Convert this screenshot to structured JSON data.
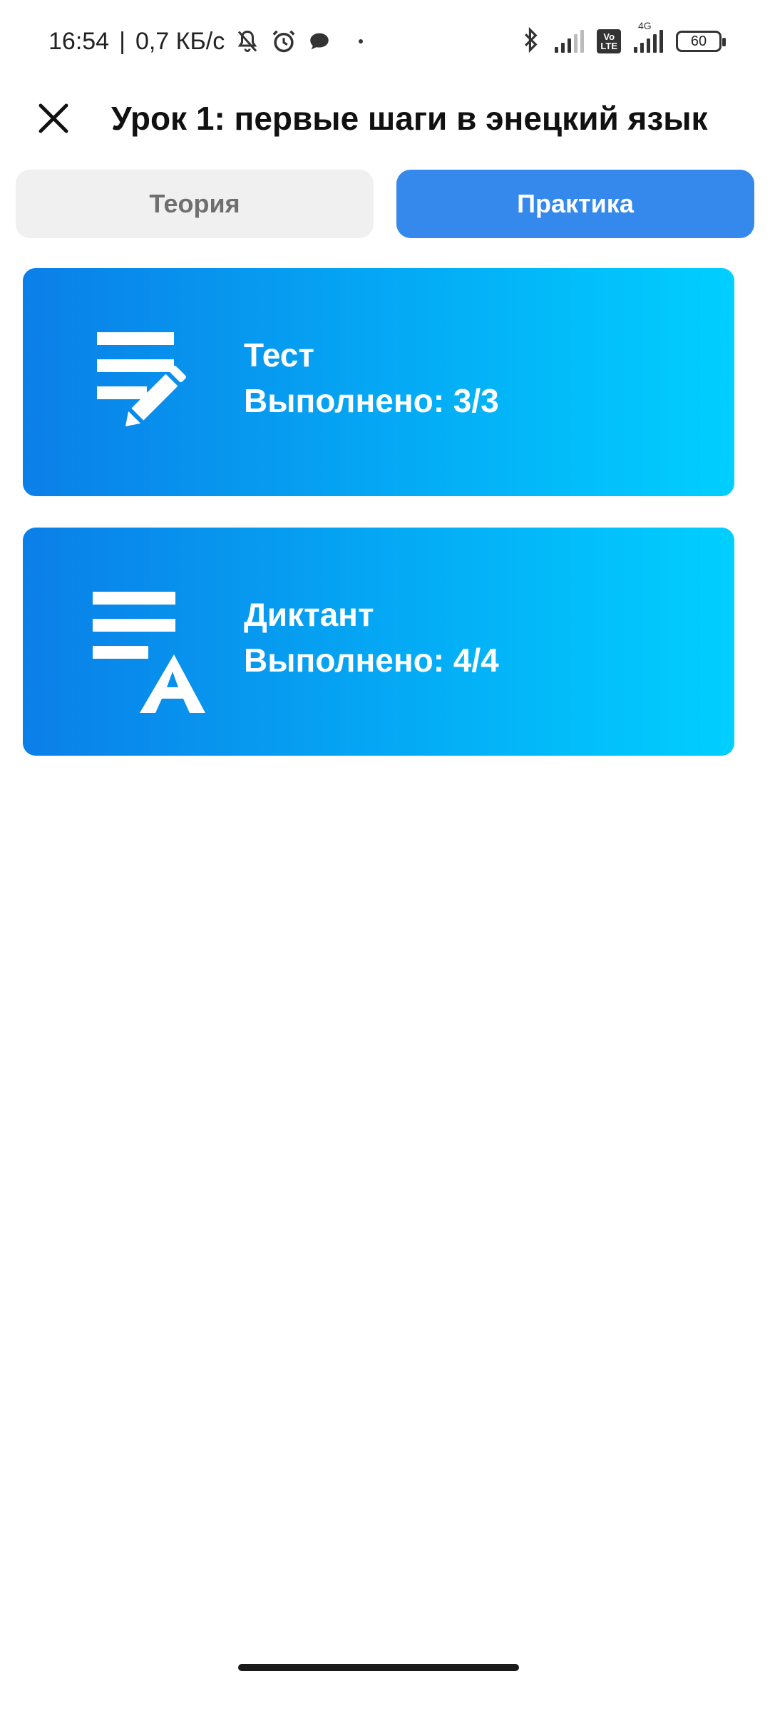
{
  "status_bar": {
    "time": "16:54",
    "separator": "|",
    "speed": "0,7 КБ/с",
    "network_label": "4G",
    "volte_label": "Vo LTE",
    "battery": "60",
    "icons": [
      "bell-off-icon",
      "alarm-icon",
      "chat-bubble-icon",
      "bluetooth-icon",
      "signal-icon",
      "volte-icon",
      "signal-4g-icon",
      "battery-icon"
    ]
  },
  "header": {
    "title": "Урок 1: первые шаги в энецкий язык",
    "close_icon": "close-icon"
  },
  "tabs": [
    {
      "label": "Теория",
      "active": false
    },
    {
      "label": "Практика",
      "active": true
    }
  ],
  "cards": [
    {
      "title": "Тест",
      "status": "Выполнено: 3/3",
      "icon": "edit-list-icon"
    },
    {
      "title": "Диктант",
      "status": "Выполнено: 4/4",
      "icon": "text-format-icon"
    }
  ],
  "colors": {
    "accent": "#3588ec",
    "card_gradient_start": "#0a7fe8",
    "card_gradient_end": "#00cfff",
    "tab_inactive_bg": "#f0f0f0"
  }
}
